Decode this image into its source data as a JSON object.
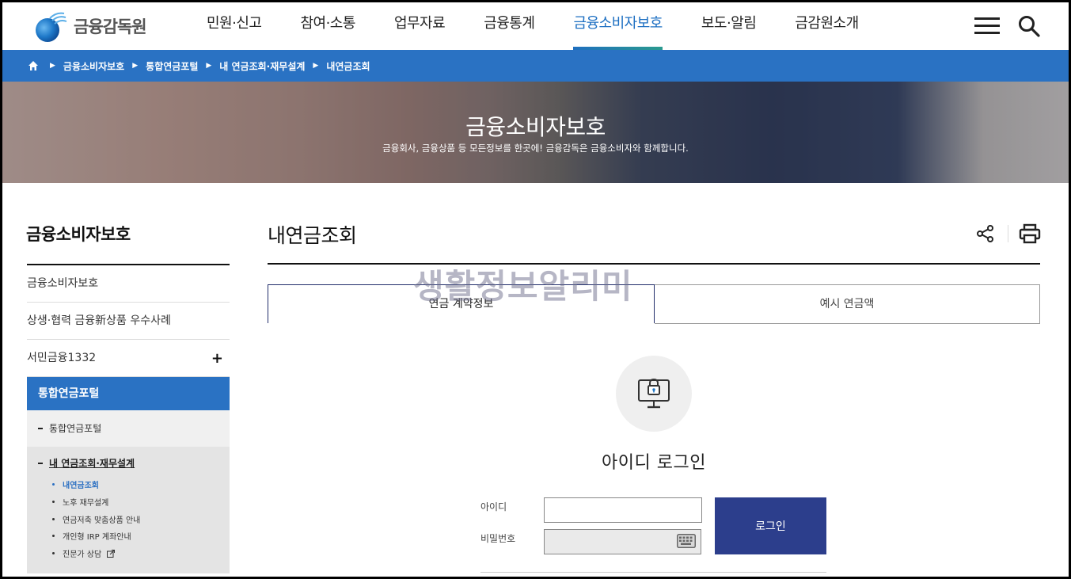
{
  "header": {
    "logo_text": "금융감독원",
    "nav": [
      "민원·신고",
      "참여·소통",
      "업무자료",
      "금융통계",
      "금융소비자보호",
      "보도·알림",
      "금감원소개"
    ],
    "active_nav": 4,
    "icons": {
      "menu": "hamburger-menu-icon",
      "search": "search-icon"
    }
  },
  "breadcrumb": {
    "home_icon": "home-icon",
    "items": [
      "금융소비자보호",
      "통합연금포털",
      "내 연금조회·재무설계",
      "내연금조회"
    ]
  },
  "hero": {
    "title": "금융소비자보호",
    "subtitle": "금융회사, 금융상품 등 모든정보를 한곳에! 금융감독은 금융소비자와 함께합니다."
  },
  "sidebar": {
    "title": "금융소비자보호",
    "items": [
      "금융소비자보호",
      "상생·협력 금융新상품 우수사례",
      "서민금융1332"
    ],
    "expand_label": "+",
    "active": "통합연금포털",
    "sub1": "통합연금포털",
    "sub2": "내 연금조회·재무설계",
    "leaves": [
      "내연금조회",
      "노후 재무설계",
      "연금저축 맞춤상품 안내",
      "개인형 IRP 계좌안내",
      "진문가 상담"
    ],
    "current_leaf": 0
  },
  "content": {
    "title": "내연금조회",
    "tabs": [
      "연금 계약정보",
      "예시 연금액"
    ],
    "watermark": "생활정보알리미",
    "login": {
      "title": "아이디 로그인",
      "id_label": "아이디",
      "pw_label": "비밀번호",
      "id_value": "",
      "pw_value": "",
      "button": "로그인"
    }
  },
  "colors": {
    "brand_blue": "#2a72c3",
    "nav_active": "#1d6fc2",
    "login_button": "#2c3e8c",
    "tab_border": "#222e6b"
  }
}
